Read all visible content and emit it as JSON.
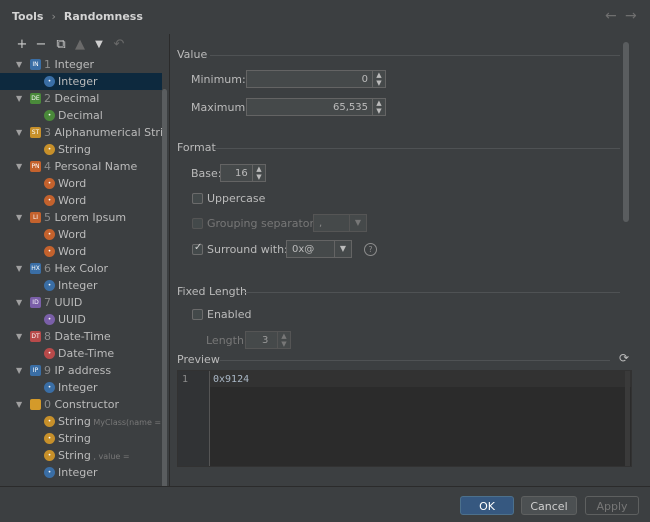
{
  "header": {
    "breadcrumb": [
      "Tools",
      "Randomness"
    ],
    "nav_back_icon": "arrow-left-icon",
    "nav_forward_icon": "arrow-right-icon"
  },
  "toolbar": {
    "add_icon": "plus-icon",
    "remove_icon": "minus-icon",
    "copy_icon": "copy-icon",
    "up_icon": "arrow-up-icon",
    "down_icon": "arrow-down-icon",
    "reset_icon": "undo-icon"
  },
  "tree": [
    {
      "level": 0,
      "num": "1",
      "label": "Integer",
      "icon": "IN",
      "color": "#3a6ea5",
      "expanded": true
    },
    {
      "level": 1,
      "label": "Integer",
      "icon": "•",
      "color": "#3a6ea5",
      "circle": true,
      "selected": true
    },
    {
      "level": 0,
      "num": "2",
      "label": "Decimal",
      "icon": "DE",
      "color": "#4a8a3a",
      "expanded": true
    },
    {
      "level": 1,
      "label": "Decimal",
      "icon": "•",
      "color": "#4a8a3a",
      "circle": true
    },
    {
      "level": 0,
      "num": "3",
      "label": "Alphanumerical String",
      "icon": "ST",
      "color": "#c7902a",
      "expanded": true
    },
    {
      "level": 1,
      "label": "String",
      "icon": "•",
      "color": "#c7902a",
      "circle": true
    },
    {
      "level": 0,
      "num": "4",
      "label": "Personal Name",
      "icon": "PN",
      "color": "#c4622d",
      "expanded": true
    },
    {
      "level": 1,
      "label": "Word",
      "icon": "•",
      "color": "#c4622d",
      "circle": true
    },
    {
      "level": 1,
      "label": "Word",
      "icon": "•",
      "color": "#c4622d",
      "circle": true
    },
    {
      "level": 0,
      "num": "5",
      "label": "Lorem Ipsum",
      "icon": "LI",
      "color": "#c4622d",
      "expanded": true
    },
    {
      "level": 1,
      "label": "Word",
      "icon": "•",
      "color": "#c4622d",
      "circle": true
    },
    {
      "level": 1,
      "label": "Word",
      "icon": "•",
      "color": "#c4622d",
      "circle": true
    },
    {
      "level": 0,
      "num": "6",
      "label": "Hex Color",
      "icon": "HX",
      "color": "#3a6ea5",
      "expanded": true
    },
    {
      "level": 1,
      "label": "Integer",
      "icon": "•",
      "color": "#3a6ea5",
      "circle": true
    },
    {
      "level": 0,
      "num": "7",
      "label": "UUID",
      "icon": "ID",
      "color": "#7a5fa8",
      "expanded": true
    },
    {
      "level": 1,
      "label": "UUID",
      "icon": "•",
      "color": "#7a5fa8",
      "circle": true
    },
    {
      "level": 0,
      "num": "8",
      "label": "Date-Time",
      "icon": "DT",
      "color": "#b84a4a",
      "expanded": true
    },
    {
      "level": 1,
      "label": "Date-Time",
      "icon": "•",
      "color": "#b84a4a",
      "circle": true
    },
    {
      "level": 0,
      "num": "9",
      "label": "IP address",
      "icon": "IP",
      "color": "#3a6ea5",
      "expanded": true
    },
    {
      "level": 1,
      "label": "Integer",
      "icon": "•",
      "color": "#3a6ea5",
      "circle": true
    },
    {
      "level": 0,
      "num": "0",
      "label": "Constructor",
      "icon": "",
      "color": "#d49a2a",
      "expanded": true
    },
    {
      "level": 1,
      "label": "String",
      "icon": "•",
      "color": "#c7902a",
      "circle": true,
      "hint": "MyClass(name ="
    },
    {
      "level": 1,
      "label": "String",
      "icon": "•",
      "color": "#c7902a",
      "circle": true
    },
    {
      "level": 1,
      "label": "String",
      "icon": "•",
      "color": "#c7902a",
      "circle": true,
      "hint": ", value ="
    },
    {
      "level": 1,
      "label": "Integer",
      "icon": "•",
      "color": "#3a6ea5",
      "circle": true
    }
  ],
  "value": {
    "section": "Value",
    "minimum_label": "Minimum:",
    "minimum": "0",
    "maximum_label": "Maximum:",
    "maximum": "65,535"
  },
  "format": {
    "section": "Format",
    "base_label": "Base:",
    "base": "16",
    "uppercase_label": "Uppercase",
    "uppercase_checked": false,
    "grouping_label": "Grouping separator:",
    "grouping_value": ",",
    "surround_label": "Surround with:",
    "surround_checked": true,
    "surround_value": "0x@",
    "help_icon": "question-circle-icon"
  },
  "fixed_length": {
    "section": "Fixed Length",
    "enabled_label": "Enabled",
    "enabled_checked": false,
    "length_label": "Length:",
    "length": "3"
  },
  "preview": {
    "section": "Preview",
    "refresh_icon": "refresh-icon",
    "line_number": "1",
    "text": "0x9124"
  },
  "footer": {
    "ok": "OK",
    "cancel": "Cancel",
    "apply": "Apply"
  }
}
